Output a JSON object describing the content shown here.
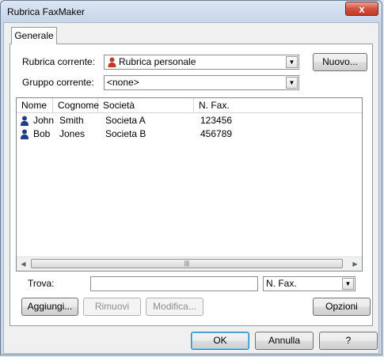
{
  "window": {
    "title": "Rubrica FaxMaker",
    "close_glyph": "x"
  },
  "tabs": [
    {
      "label": "Generale",
      "active": true
    }
  ],
  "rubrica": {
    "label": "Rubrica corrente:",
    "value": "Rubrica personale"
  },
  "gruppo": {
    "label": "Gruppo corrente:",
    "value": "<none>"
  },
  "nuovo_label": "Nuovo...",
  "list": {
    "columns": [
      "Nome",
      "Cognome",
      "Società",
      "N. Fax."
    ],
    "rows": [
      {
        "nome": "John",
        "cognome": "Smith",
        "societa": "Societa A",
        "fax": "123456",
        "icon": "person-icon"
      },
      {
        "nome": "Bob",
        "cognome": "Jones",
        "societa": "Societa B",
        "fax": "456789",
        "icon": "person-icon"
      }
    ]
  },
  "trova": {
    "label": "Trova:",
    "value": "",
    "field_value": "N. Fax."
  },
  "buttons": {
    "aggiungi": "Aggiungi...",
    "rimuovi": "Rimuovi",
    "modifica": "Modifica...",
    "opzioni": "Opzioni",
    "ok": "OK",
    "annulla": "Annulla",
    "help": "?"
  },
  "colors": {
    "rubrica_icon": "#c0392b",
    "contact_icon": "#1f3b8c"
  }
}
